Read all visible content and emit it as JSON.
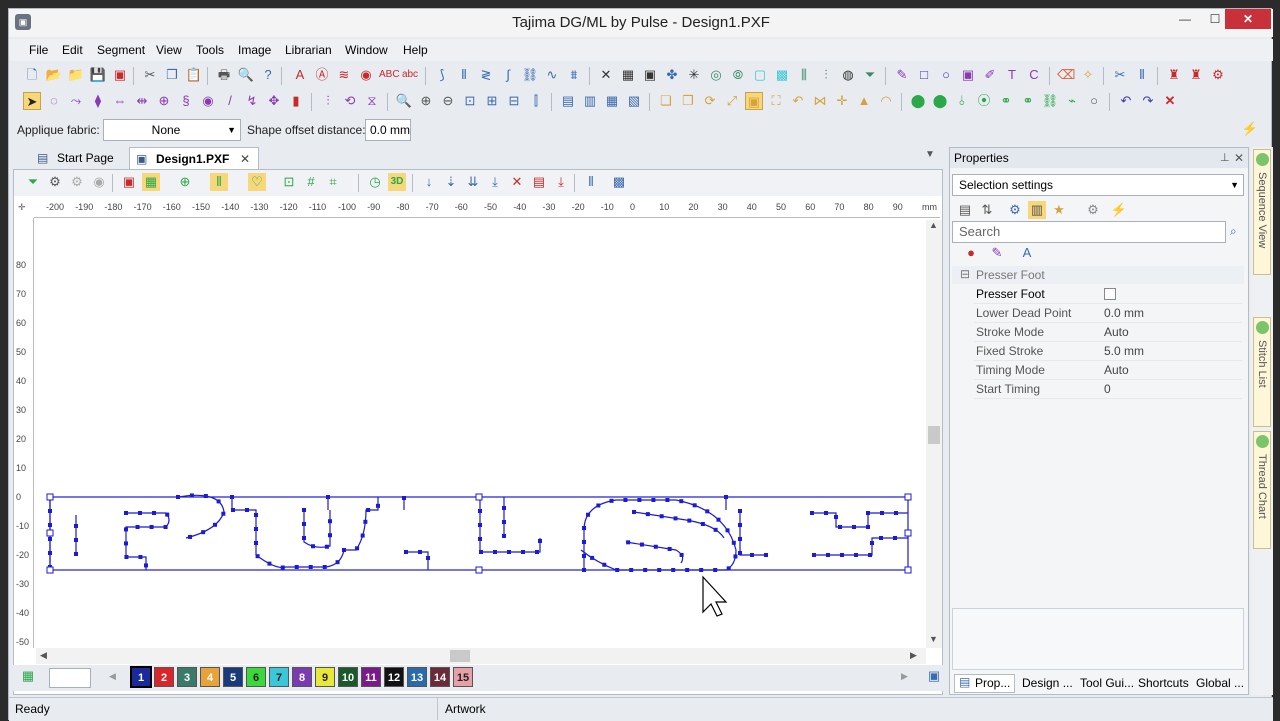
{
  "window": {
    "title": "Tajima DG/ML by Pulse - Design1.PXF",
    "controls": {
      "minimize": "—",
      "maximize": "☐",
      "close": "✕"
    }
  },
  "menu": [
    "File",
    "Edit",
    "Segment",
    "View",
    "Tools",
    "Image",
    "Librarian",
    "Window",
    "Help"
  ],
  "options": {
    "applique_label": "Applique fabric:",
    "applique_value": "None",
    "shape_offset_label": "Shape offset distance:",
    "shape_offset_value": "0.0 mm"
  },
  "tabs": [
    {
      "label": "Start Page",
      "icon": "start-page-icon"
    },
    {
      "label": "Design1.PXF",
      "icon": "design-file-icon",
      "close": "✕"
    }
  ],
  "ruler": {
    "unit": "mm",
    "h_ticks": [
      "-200",
      "-190",
      "-180",
      "-170",
      "-160",
      "-150",
      "-140",
      "-130",
      "-120",
      "-110",
      "-100",
      "-90",
      "-80",
      "-70",
      "-60",
      "-50",
      "-40",
      "-30",
      "-20",
      "-10",
      "0",
      "10",
      "20",
      "30",
      "40",
      "50",
      "60",
      "70",
      "80",
      "90"
    ],
    "v_ticks": [
      "80",
      "70",
      "60",
      "50",
      "40",
      "30",
      "20",
      "10",
      "0",
      "-10",
      "-20",
      "-30",
      "-40",
      "-50"
    ]
  },
  "thread_colors": [
    {
      "n": "1",
      "color": "#1a2a9a"
    },
    {
      "n": "2",
      "color": "#d8242a"
    },
    {
      "n": "3",
      "color": "#3a7a6a"
    },
    {
      "n": "4",
      "color": "#e8a23a"
    },
    {
      "n": "5",
      "color": "#1a3a7a"
    },
    {
      "n": "6",
      "color": "#3ad83a"
    },
    {
      "n": "7",
      "color": "#3ac8d8"
    },
    {
      "n": "8",
      "color": "#7a3ab0"
    },
    {
      "n": "9",
      "color": "#e8e83a"
    },
    {
      "n": "10",
      "color": "#1a5a2a"
    },
    {
      "n": "11",
      "color": "#7a1a8a"
    },
    {
      "n": "12",
      "color": "#111111"
    },
    {
      "n": "13",
      "color": "#2a6aa8"
    },
    {
      "n": "14",
      "color": "#6a2a3a"
    },
    {
      "n": "15",
      "color": "#e8a0a8"
    }
  ],
  "status": {
    "left": "Ready",
    "mid": "Artwork"
  },
  "properties": {
    "title": "Properties",
    "dropdown": "Selection settings",
    "search_placeholder": "Search",
    "group": "Presser Foot",
    "rows": [
      {
        "key": "Presser Foot",
        "value": ""
      },
      {
        "key": "Lower Dead Point",
        "value": "0.0 mm"
      },
      {
        "key": "Stroke Mode",
        "value": "Auto"
      },
      {
        "key": "Fixed Stroke",
        "value": "5.0 mm"
      },
      {
        "key": "Timing Mode",
        "value": "Auto"
      },
      {
        "key": "Start Timing",
        "value": "0"
      }
    ],
    "bottom_tabs": [
      "Prop...",
      "Design ...",
      "Tool Gui...",
      "Shortcuts",
      "Global ..."
    ]
  },
  "side_tabs": [
    "Sequence View",
    "Stitch List",
    "Thread Chart"
  ],
  "accent": "#1a1ad8"
}
